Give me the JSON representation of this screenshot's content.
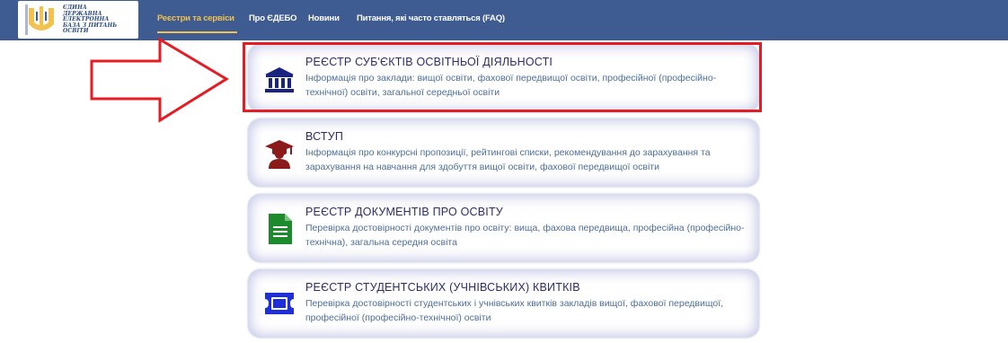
{
  "header": {
    "logo_lines": [
      "ЄДИНА",
      "ДЕРЖАВНА",
      "ЕЛЕКТРОННА",
      "БАЗА З ПИТАНЬ",
      "ОСВІТИ"
    ],
    "nav": [
      {
        "label": "Реєстри та сервіси",
        "active": true
      },
      {
        "label": "Про ЄДЕБО",
        "active": false
      },
      {
        "label": "Новини",
        "active": false
      },
      {
        "label": "Питання, які часто ставляться (FAQ)",
        "active": false
      }
    ],
    "bar_color": "#3f5c92",
    "active_color": "#f2c14e"
  },
  "cards": [
    {
      "icon": "institution-building-icon",
      "title": "РЕЄСТР СУБ'ЄКТІВ ОСВІТНЬОЇ ДІЯЛЬНОСТІ",
      "desc": "Інформація про заклади: вищої освіти, фахової передвищої освіти, професійної (професійно-технічної) освіти, загальної середньої освіти",
      "highlighted": true
    },
    {
      "icon": "graduate-icon",
      "title": "ВСТУП",
      "desc": "Інформація про конкурсні пропозиції, рейтингові списки, рекомендування до зарахування та зарахування на навчання для здобуття вищої освіти, фахової передвищої освіти",
      "highlighted": false
    },
    {
      "icon": "document-icon",
      "title": "РЕЄСТР ДОКУМЕНТІВ ПРО ОСВІТУ",
      "desc": "Перевірка достовірності документів про освіту: вища, фахова передвища, професійна (професійно-технічна), загальна середня освіта",
      "highlighted": false
    },
    {
      "icon": "ticket-icon",
      "title": "РЕЄСТР СТУДЕНТСЬКИХ (УЧНІВСЬКИХ) КВИТКІВ",
      "desc": "Перевірка достовірності студентських і учнівських квитків закладів вищої, фахової передвищої, професійної (професійно-технічної) освіти",
      "highlighted": false
    }
  ],
  "annotation": {
    "arrow": "right-arrow-icon",
    "color": "#e51c23"
  }
}
